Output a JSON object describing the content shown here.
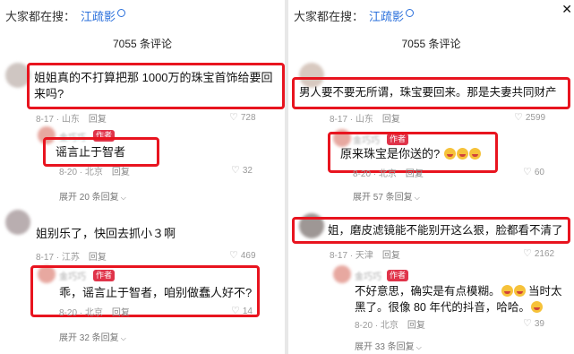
{
  "left": {
    "search_prefix": "大家都在搜：",
    "search_keyword": "江疏影",
    "comment_count": "7055 条评论",
    "comments": [
      {
        "text": "姐姐真的不打算把那 1000万的珠宝首饰给要回来吗?",
        "date": "8-17 · 山东",
        "reply": "回复",
        "likes": "728",
        "author_reply": {
          "username": "金巧巧",
          "badge": "作者",
          "text": "谣言止于智者",
          "date": "8-20 · 北京",
          "reply": "回复",
          "likes": "32"
        },
        "expand": "展开 20 条回复"
      },
      {
        "text": "姐别乐了，快回去抓小３啊",
        "date": "8-17 · 江苏",
        "reply": "回复",
        "likes": "469",
        "author_reply": {
          "username": "金巧巧",
          "badge": "作者",
          "text": "乖，谣言止于智者，咱别做蠢人好不?",
          "date": "8-20 · 北京",
          "reply": "回复",
          "likes": "14"
        },
        "expand": "展开 32 条回复"
      }
    ]
  },
  "right": {
    "search_prefix": "大家都在搜：",
    "search_keyword": "江疏影",
    "comment_count": "7055 条评论",
    "comments": [
      {
        "text": "男人要不要无所谓，珠宝要回来。那是夫妻共同财产",
        "date": "8-17 · 山东",
        "reply": "回复",
        "likes": "2599",
        "author_reply": {
          "username": "金巧巧",
          "badge": "作者",
          "text": "原来珠宝是你送的?",
          "date": "8-20 · 北京",
          "reply": "回复",
          "likes": "60"
        },
        "expand": "展开 57 条回复"
      },
      {
        "text": "姐，磨皮滤镜能不能别开这么狠，脸都看不清了",
        "date": "8-17 · 天津",
        "reply": "回复",
        "likes": "2162",
        "author_reply": {
          "username": "金巧巧",
          "badge": "作者",
          "text_a": "不好意思，确实是有点模糊。",
          "text_b": "当时太黑了。很像 80 年代的抖音，哈哈。",
          "date": "8-20 · 北京",
          "reply": "回复",
          "likes": "39"
        },
        "expand": "展开 33 条回复"
      }
    ]
  },
  "colors": {
    "highlight_border": "#e8141f",
    "author_badge": "#e0344a",
    "search_keyword": "#2a6fdb"
  }
}
